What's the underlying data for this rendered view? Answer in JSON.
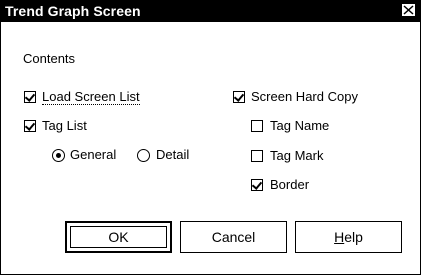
{
  "window": {
    "title": "Trend Graph Screen"
  },
  "group": {
    "label": "Contents"
  },
  "left_options": [
    {
      "label": "Load Screen List",
      "checked": true
    },
    {
      "label": "Tag List",
      "checked": true
    }
  ],
  "radios": [
    {
      "label": "General",
      "selected": true
    },
    {
      "label": "Detail",
      "selected": false
    }
  ],
  "right_options": [
    {
      "label": "Screen Hard Copy",
      "checked": true
    },
    {
      "label": "Tag Name",
      "checked": false
    },
    {
      "label": "Tag Mark",
      "checked": false
    },
    {
      "label": "Border",
      "checked": true
    }
  ],
  "buttons": {
    "ok": "OK",
    "cancel": "Cancel",
    "help": "Help"
  }
}
